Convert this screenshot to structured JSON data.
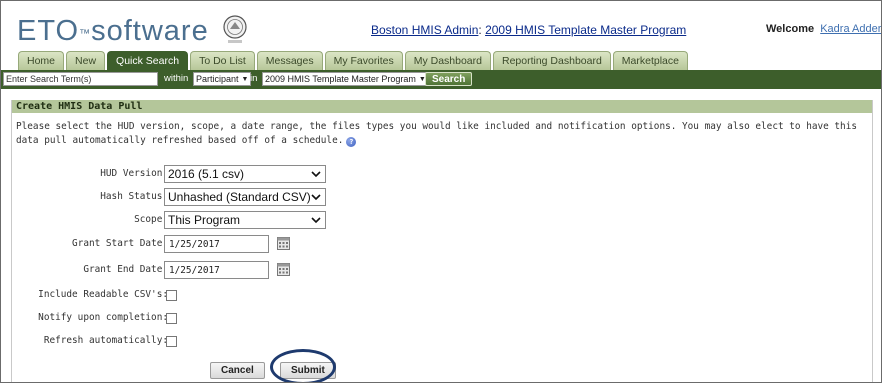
{
  "header": {
    "logo_text": "ETO",
    "logo_tm": "™",
    "logo_rest": "software",
    "admin_prefix": "Boston HMIS Admin",
    "admin_sep": ": ",
    "program_link": "2009 HMIS Template Master Program",
    "welcome_label": "Welcome",
    "welcome_user": "Kadra Adderly"
  },
  "tabs": [
    {
      "label": "Home"
    },
    {
      "label": "New"
    },
    {
      "label": "Quick Search",
      "active": true
    },
    {
      "label": "To Do List"
    },
    {
      "label": "Messages"
    },
    {
      "label": "My Favorites"
    },
    {
      "label": "My Dashboard"
    },
    {
      "label": "Reporting Dashboard"
    },
    {
      "label": "Marketplace"
    }
  ],
  "searchbar": {
    "input_value": "Enter Search Term(s)",
    "within_label": "within",
    "scope_value": "Participant",
    "in_label": "in",
    "program_value": "2009 HMIS Template Master Program",
    "search_button": "Search"
  },
  "panel": {
    "title": "Create HMIS Data Pull",
    "intro": "Please select the HUD version, scope, a date range, the files types you would like included and notification options. You may also elect to have this data pull automatically refreshed based off of a schedule.",
    "fields": {
      "hud_version_label": "HUD Version:",
      "hud_version_value": "2016 (5.1 csv)",
      "hash_status_label": "Hash Status:",
      "hash_status_value": "Unhashed (Standard CSV)",
      "scope_label": "Scope:",
      "scope_value": "This Program",
      "grant_start_label": "Grant Start Date:",
      "grant_start_value": "1/25/2017",
      "grant_end_label": "Grant End Date:",
      "grant_end_value": "1/25/2017",
      "readable_csv_label": "Include Readable CSV's:",
      "notify_label": "Notify upon completion:",
      "refresh_label": "Refresh automatically:"
    },
    "buttons": {
      "cancel": "Cancel",
      "submit": "Submit"
    }
  },
  "colors": {
    "nav_green": "#3d5e2b",
    "panel_title_bg": "#b4c69a",
    "highlight_circle": "#1e3a6e"
  }
}
